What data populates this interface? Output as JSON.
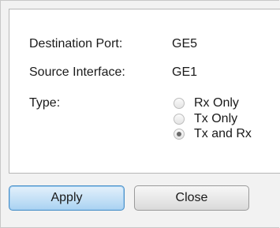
{
  "dialog": {
    "destination_port_label": "Destination Port:",
    "destination_port_value": "GE5",
    "source_interface_label": "Source Interface:",
    "source_interface_value": "GE1",
    "type_label": "Type:",
    "type_options": [
      {
        "label": "Rx Only",
        "selected": false
      },
      {
        "label": "Tx Only",
        "selected": false
      },
      {
        "label": "Tx and Rx",
        "selected": true
      }
    ]
  },
  "buttons": {
    "apply_label": "Apply",
    "close_label": "Close"
  }
}
